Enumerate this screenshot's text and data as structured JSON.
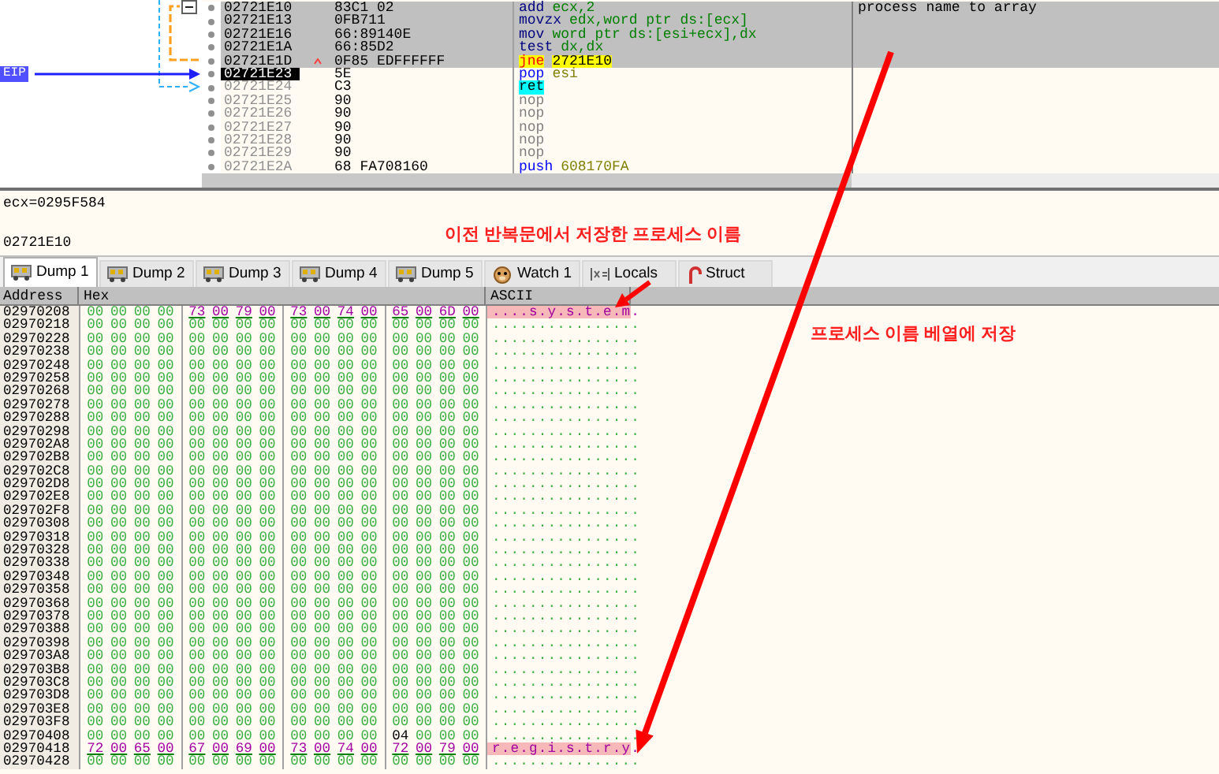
{
  "disassembly": {
    "eip_label": "EIP",
    "rows": [
      {
        "address": "02721E10",
        "bytes": "83C1 02",
        "mnemonic": "add",
        "operands": "ecx,2",
        "kind": "arith",
        "selected": true,
        "current": false,
        "jump_mark": false,
        "comment": "process name to array"
      },
      {
        "address": "02721E13",
        "bytes": "0FB711",
        "mnemonic": "movzx",
        "operands": "edx,word ptr ds:[ecx]",
        "kind": "arith",
        "selected": true,
        "current": false,
        "jump_mark": false
      },
      {
        "address": "02721E16",
        "bytes": "66:89140E",
        "mnemonic": "mov",
        "operands": "word ptr ds:[esi+ecx],dx",
        "kind": "arith",
        "selected": true,
        "current": false,
        "jump_mark": false
      },
      {
        "address": "02721E1A",
        "bytes": "66:85D2",
        "mnemonic": "test",
        "operands": "dx,dx",
        "kind": "arith",
        "selected": true,
        "current": false,
        "jump_mark": false
      },
      {
        "address": "02721E1D",
        "bytes": "0F85 EDFFFFFF",
        "mnemonic": "jne",
        "operands": "2721E10",
        "kind": "jump",
        "selected": true,
        "current": false,
        "jump_mark": true
      },
      {
        "address": "02721E23",
        "bytes": "5E",
        "mnemonic": "pop",
        "operands": "esi",
        "kind": "stack",
        "selected": false,
        "current": true,
        "jump_mark": false
      },
      {
        "address": "02721E24",
        "bytes": "C3",
        "mnemonic": "ret",
        "kind": "return",
        "selected": false,
        "current": false,
        "jump_mark": false
      },
      {
        "address": "02721E25",
        "bytes": "90",
        "mnemonic": "nop",
        "kind": "nop",
        "selected": false,
        "current": false,
        "jump_mark": false
      },
      {
        "address": "02721E26",
        "bytes": "90",
        "mnemonic": "nop",
        "kind": "nop",
        "selected": false,
        "current": false,
        "jump_mark": false
      },
      {
        "address": "02721E27",
        "bytes": "90",
        "mnemonic": "nop",
        "kind": "nop",
        "selected": false,
        "current": false,
        "jump_mark": false
      },
      {
        "address": "02721E28",
        "bytes": "90",
        "mnemonic": "nop",
        "kind": "nop",
        "selected": false,
        "current": false,
        "jump_mark": false
      },
      {
        "address": "02721E29",
        "bytes": "90",
        "mnemonic": "nop",
        "kind": "nop",
        "selected": false,
        "current": false,
        "jump_mark": false
      },
      {
        "address": "02721E2A",
        "bytes": "68 FA708160",
        "mnemonic": "push",
        "operands": "608170FA",
        "kind": "stack",
        "selected": false,
        "current": false,
        "jump_mark": false
      }
    ]
  },
  "info": {
    "lines": [
      "ecx=0295F584",
      "02721E10"
    ]
  },
  "tabs": [
    {
      "label": "Dump 1",
      "kind": "dump",
      "selected": true
    },
    {
      "label": "Dump 2",
      "kind": "dump",
      "selected": false
    },
    {
      "label": "Dump 3",
      "kind": "dump",
      "selected": false
    },
    {
      "label": "Dump 4",
      "kind": "dump",
      "selected": false
    },
    {
      "label": "Dump 5",
      "kind": "dump",
      "selected": false
    },
    {
      "label": "Watch 1",
      "kind": "watch",
      "selected": false
    },
    {
      "label": "Locals",
      "kind": "locals",
      "selected": false
    },
    {
      "label": "Struct",
      "kind": "struct",
      "selected": false
    }
  ],
  "dump": {
    "columns": [
      "Address",
      "Hex",
      "ASCII"
    ],
    "rows": [
      {
        "address": "02970208",
        "hex": "00 00 00 00 73 00 79 00 73 00 74 00 65 00 6D 00",
        "ascii": "....s.y.s.t.e.m.",
        "highlighted": true
      },
      {
        "address": "02970218",
        "hex": "00 00 00 00 00 00 00 00 00 00 00 00 00 00 00 00",
        "ascii": "................",
        "highlighted": false
      },
      {
        "address": "02970228",
        "hex": "00 00 00 00 00 00 00 00 00 00 00 00 00 00 00 00",
        "ascii": "................",
        "highlighted": false
      },
      {
        "address": "02970238",
        "hex": "00 00 00 00 00 00 00 00 00 00 00 00 00 00 00 00",
        "ascii": "................",
        "highlighted": false
      },
      {
        "address": "02970248",
        "hex": "00 00 00 00 00 00 00 00 00 00 00 00 00 00 00 00",
        "ascii": "................",
        "highlighted": false
      },
      {
        "address": "02970258",
        "hex": "00 00 00 00 00 00 00 00 00 00 00 00 00 00 00 00",
        "ascii": "................",
        "highlighted": false
      },
      {
        "address": "02970268",
        "hex": "00 00 00 00 00 00 00 00 00 00 00 00 00 00 00 00",
        "ascii": "................",
        "highlighted": false
      },
      {
        "address": "02970278",
        "hex": "00 00 00 00 00 00 00 00 00 00 00 00 00 00 00 00",
        "ascii": "................",
        "highlighted": false
      },
      {
        "address": "02970288",
        "hex": "00 00 00 00 00 00 00 00 00 00 00 00 00 00 00 00",
        "ascii": "................",
        "highlighted": false
      },
      {
        "address": "02970298",
        "hex": "00 00 00 00 00 00 00 00 00 00 00 00 00 00 00 00",
        "ascii": "................",
        "highlighted": false
      },
      {
        "address": "029702A8",
        "hex": "00 00 00 00 00 00 00 00 00 00 00 00 00 00 00 00",
        "ascii": "................",
        "highlighted": false
      },
      {
        "address": "029702B8",
        "hex": "00 00 00 00 00 00 00 00 00 00 00 00 00 00 00 00",
        "ascii": "................",
        "highlighted": false
      },
      {
        "address": "029702C8",
        "hex": "00 00 00 00 00 00 00 00 00 00 00 00 00 00 00 00",
        "ascii": "................",
        "highlighted": false
      },
      {
        "address": "029702D8",
        "hex": "00 00 00 00 00 00 00 00 00 00 00 00 00 00 00 00",
        "ascii": "................",
        "highlighted": false
      },
      {
        "address": "029702E8",
        "hex": "00 00 00 00 00 00 00 00 00 00 00 00 00 00 00 00",
        "ascii": "................",
        "highlighted": false
      },
      {
        "address": "029702F8",
        "hex": "00 00 00 00 00 00 00 00 00 00 00 00 00 00 00 00",
        "ascii": "................",
        "highlighted": false
      },
      {
        "address": "02970308",
        "hex": "00 00 00 00 00 00 00 00 00 00 00 00 00 00 00 00",
        "ascii": "................",
        "highlighted": false
      },
      {
        "address": "02970318",
        "hex": "00 00 00 00 00 00 00 00 00 00 00 00 00 00 00 00",
        "ascii": "................",
        "highlighted": false
      },
      {
        "address": "02970328",
        "hex": "00 00 00 00 00 00 00 00 00 00 00 00 00 00 00 00",
        "ascii": "................",
        "highlighted": false
      },
      {
        "address": "02970338",
        "hex": "00 00 00 00 00 00 00 00 00 00 00 00 00 00 00 00",
        "ascii": "................",
        "highlighted": false
      },
      {
        "address": "02970348",
        "hex": "00 00 00 00 00 00 00 00 00 00 00 00 00 00 00 00",
        "ascii": "................",
        "highlighted": false
      },
      {
        "address": "02970358",
        "hex": "00 00 00 00 00 00 00 00 00 00 00 00 00 00 00 00",
        "ascii": "................",
        "highlighted": false
      },
      {
        "address": "02970368",
        "hex": "00 00 00 00 00 00 00 00 00 00 00 00 00 00 00 00",
        "ascii": "................",
        "highlighted": false
      },
      {
        "address": "02970378",
        "hex": "00 00 00 00 00 00 00 00 00 00 00 00 00 00 00 00",
        "ascii": "................",
        "highlighted": false
      },
      {
        "address": "02970388",
        "hex": "00 00 00 00 00 00 00 00 00 00 00 00 00 00 00 00",
        "ascii": "................",
        "highlighted": false
      },
      {
        "address": "02970398",
        "hex": "00 00 00 00 00 00 00 00 00 00 00 00 00 00 00 00",
        "ascii": "................",
        "highlighted": false
      },
      {
        "address": "029703A8",
        "hex": "00 00 00 00 00 00 00 00 00 00 00 00 00 00 00 00",
        "ascii": "................",
        "highlighted": false
      },
      {
        "address": "029703B8",
        "hex": "00 00 00 00 00 00 00 00 00 00 00 00 00 00 00 00",
        "ascii": "................",
        "highlighted": false
      },
      {
        "address": "029703C8",
        "hex": "00 00 00 00 00 00 00 00 00 00 00 00 00 00 00 00",
        "ascii": "................",
        "highlighted": false
      },
      {
        "address": "029703D8",
        "hex": "00 00 00 00 00 00 00 00 00 00 00 00 00 00 00 00",
        "ascii": "................",
        "highlighted": false
      },
      {
        "address": "029703E8",
        "hex": "00 00 00 00 00 00 00 00 00 00 00 00 00 00 00 00",
        "ascii": "................",
        "highlighted": false
      },
      {
        "address": "029703F8",
        "hex": "00 00 00 00 00 00 00 00 00 00 00 00 00 00 00 00",
        "ascii": "................",
        "highlighted": false
      },
      {
        "address": "02970408",
        "hex": "00 00 00 00 00 00 00 00 00 00 00 00 04 00 00 00",
        "ascii": "................",
        "highlighted": false
      },
      {
        "address": "02970418",
        "hex": "72 00 65 00 67 00 69 00 73 00 74 00 72 00 79 00",
        "ascii": "r.e.g.i.s.t.r.y.",
        "highlighted": true
      },
      {
        "address": "02970428",
        "hex": "00 00 00 00 00 00 00 00 00 00 00 00 00 00 00 00",
        "ascii": "................",
        "highlighted": false
      }
    ]
  },
  "annotations": [
    "이전 반복문에서 저장한 프로세스 이름",
    "프로세스 이름 베열에 저장"
  ]
}
